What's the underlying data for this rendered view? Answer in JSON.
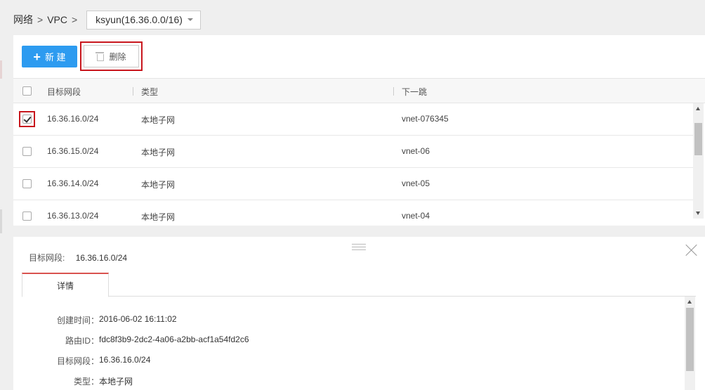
{
  "breadcrumb": {
    "network": "网络",
    "sep1": ">",
    "vpc": "VPC",
    "sep2": ">",
    "selected_vpc": "ksyun(16.36.0.0/16)"
  },
  "toolbar": {
    "new_label": "新 建",
    "new_icon": "plus-icon",
    "delete_label": "删除",
    "delete_icon": "trash-icon"
  },
  "table": {
    "columns": [
      "目标网段",
      "类型",
      "下一跳"
    ],
    "rows": [
      {
        "checked": true,
        "cidr": "16.36.16.0/24",
        "type": "本地子网",
        "next_hop": "vnet-076345"
      },
      {
        "checked": false,
        "cidr": "16.36.15.0/24",
        "type": "本地子网",
        "next_hop": "vnet-06"
      },
      {
        "checked": false,
        "cidr": "16.36.14.0/24",
        "type": "本地子网",
        "next_hop": "vnet-05"
      },
      {
        "checked": false,
        "cidr": "16.36.13.0/24",
        "type": "本地子网",
        "next_hop": "vnet-04"
      }
    ]
  },
  "detail": {
    "title_label": "目标网段:",
    "title_value": "16.36.16.0/24",
    "tab_label": "详情",
    "fields": [
      {
        "key": "创建时间：",
        "value": "2016-06-02 16:11:02"
      },
      {
        "key": "路由ID：",
        "value": "fdc8f3b9-2dc2-4a06-a2bb-acf1a54fd2c6"
      },
      {
        "key": "目标网段：",
        "value": "16.36.16.0/24"
      },
      {
        "key": "类型：",
        "value": "本地子网"
      }
    ]
  },
  "colors": {
    "primary": "#2d9bf0",
    "highlight": "#c8161d",
    "tab_accent": "#d9534f"
  }
}
